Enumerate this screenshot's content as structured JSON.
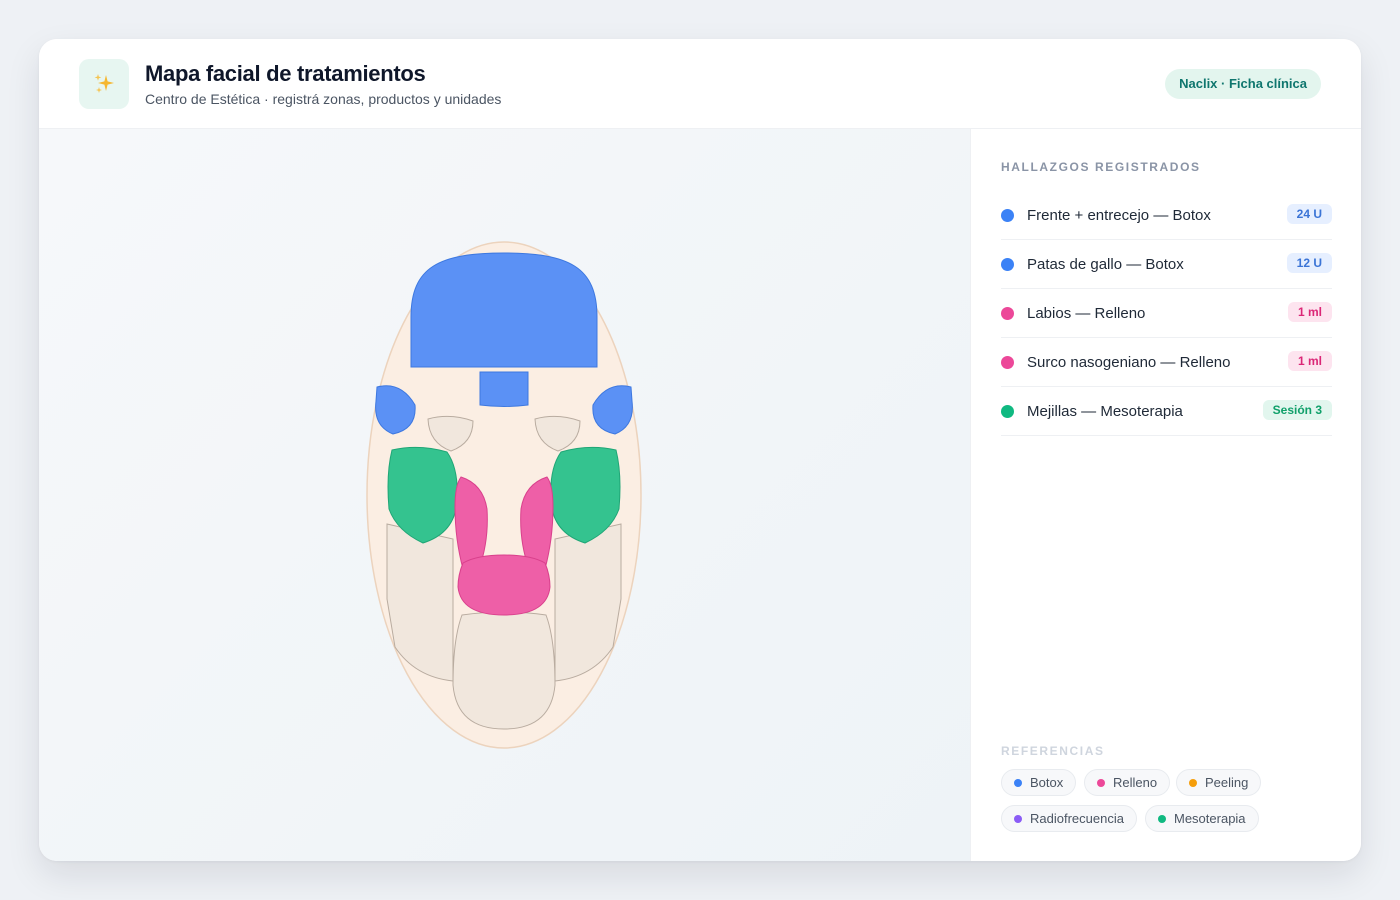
{
  "header": {
    "logo_icon": "sparkles-icon",
    "title": "Mapa facial de tratamientos",
    "subtitle": "Centro de Estética · registrá zonas, productos y unidades",
    "badge": "Naclix · Ficha clínica"
  },
  "face_map": {
    "zones": [
      {
        "id": "frente",
        "color": "#5b91f5",
        "treatment": "Botox"
      },
      {
        "id": "entrecejo",
        "color": "#5b91f5",
        "treatment": "Botox"
      },
      {
        "id": "patas-de-gallo-izquierda",
        "color": "#5b91f5",
        "treatment": "Botox"
      },
      {
        "id": "patas-de-gallo-derecha",
        "color": "#5b91f5",
        "treatment": "Botox"
      },
      {
        "id": "ojera-izquierda",
        "color": "#f1e7dd",
        "treatment": ""
      },
      {
        "id": "ojera-derecha",
        "color": "#f1e7dd",
        "treatment": ""
      },
      {
        "id": "mejilla-izquierda",
        "color": "#34c38f",
        "treatment": "Mesoterapia"
      },
      {
        "id": "mejilla-derecha",
        "color": "#34c38f",
        "treatment": "Mesoterapia"
      },
      {
        "id": "surco-izquierdo",
        "color": "#ee5fa7",
        "treatment": "Relleno"
      },
      {
        "id": "surco-derecho",
        "color": "#ee5fa7",
        "treatment": "Relleno"
      },
      {
        "id": "labios",
        "color": "#ee5fa7",
        "treatment": "Relleno"
      },
      {
        "id": "mandibula-izquierda",
        "color": "#f1e7dd",
        "treatment": ""
      },
      {
        "id": "mandibula-derecha",
        "color": "#f1e7dd",
        "treatment": ""
      },
      {
        "id": "menton",
        "color": "#f1e7dd",
        "treatment": ""
      }
    ],
    "face_color": "#fbeee3"
  },
  "sidebar": {
    "heading": "HALLAZGOS REGISTRADOS",
    "findings": [
      {
        "label": "Frente + entrecejo — Botox",
        "qty": "24 U",
        "color": "#3b82f6"
      },
      {
        "label": "Patas de gallo — Botox",
        "qty": "12 U",
        "color": "#3b82f6"
      },
      {
        "label": "Labios — Relleno",
        "qty": "1 ml",
        "color": "#ec4899"
      },
      {
        "label": "Surco nasogeniano — Relleno",
        "qty": "1 ml",
        "color": "#ec4899"
      },
      {
        "label": "Mejillas — Mesoterapia",
        "qty": "Sesión 3",
        "color": "#10b981"
      }
    ],
    "references_heading": "REFERENCIAS",
    "legend": [
      {
        "label": "Botox",
        "color": "#3b82f6"
      },
      {
        "label": "Relleno",
        "color": "#ec4899"
      },
      {
        "label": "Peeling",
        "color": "#f59e0b"
      },
      {
        "label": "Radiofrecuencia",
        "color": "#8b5cf6"
      },
      {
        "label": "Mesoterapia",
        "color": "#10b981"
      }
    ]
  }
}
